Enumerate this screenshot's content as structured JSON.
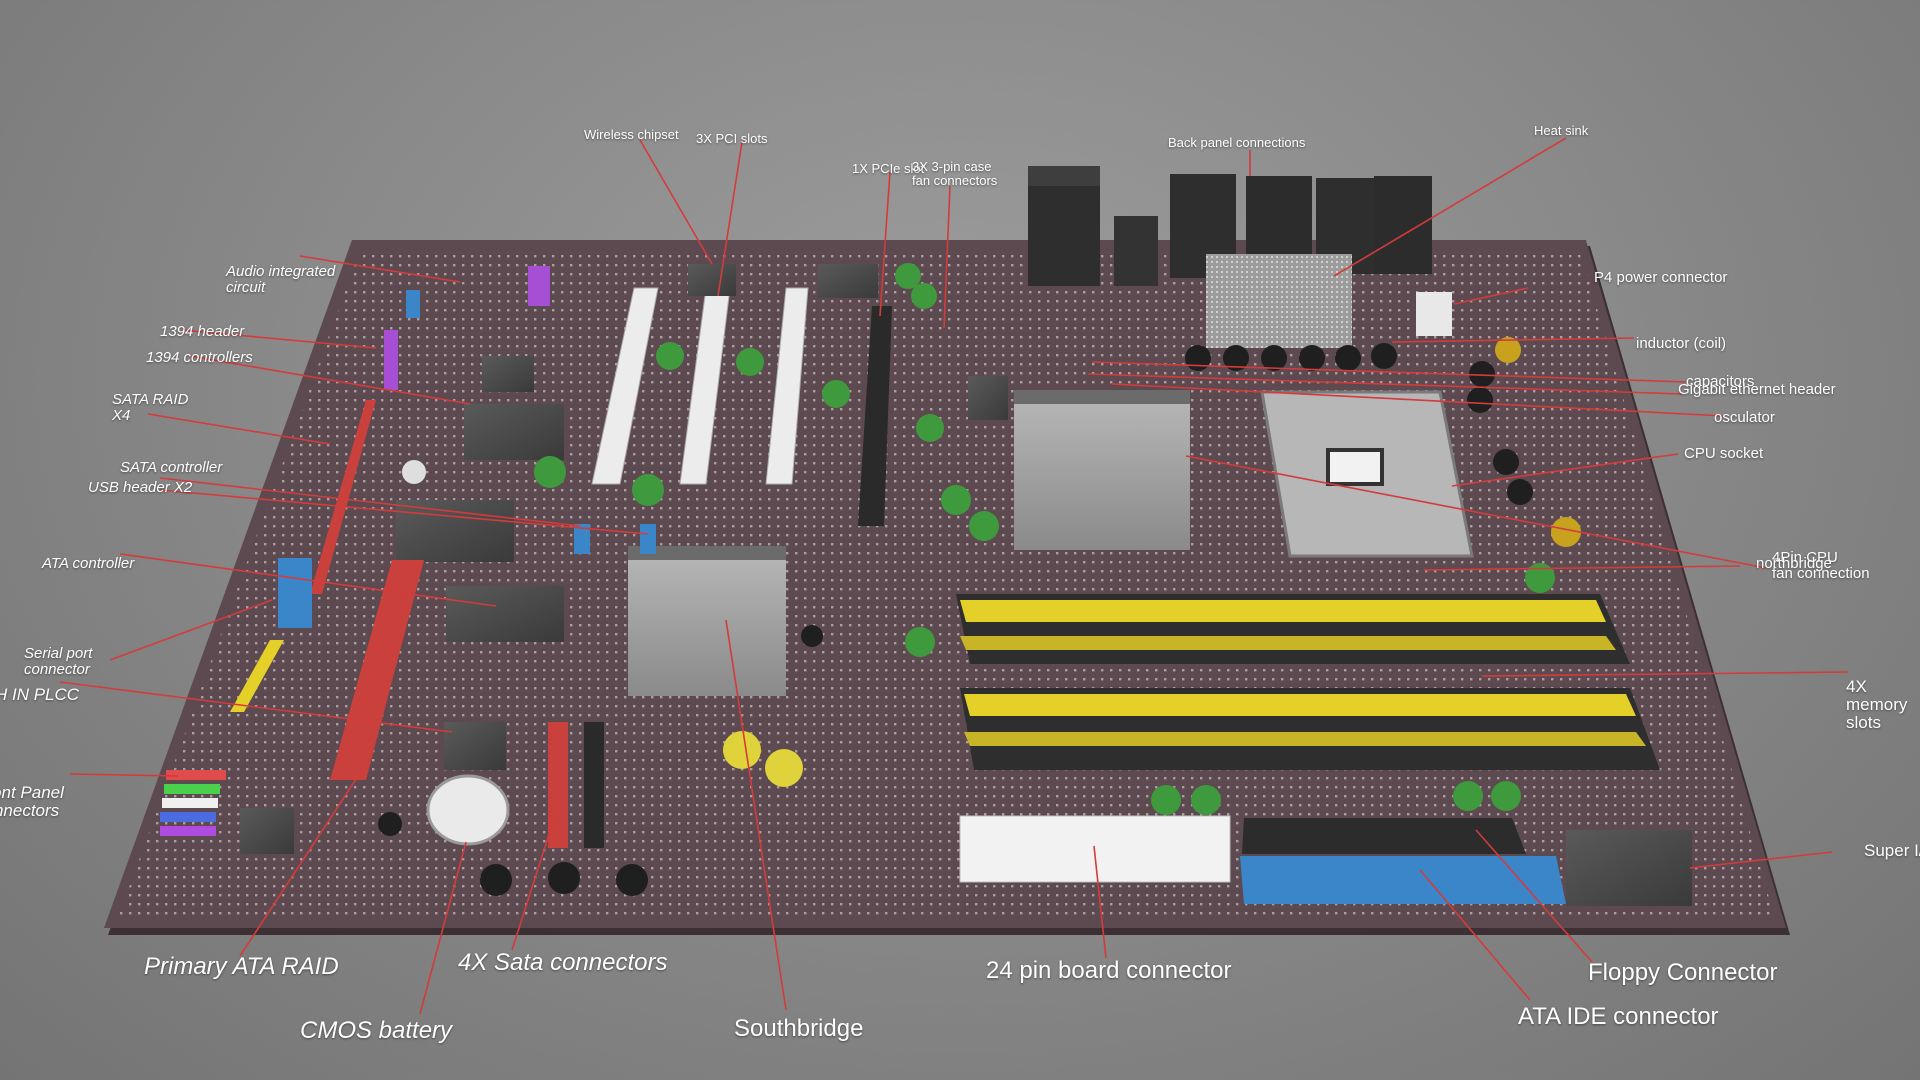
{
  "colors": {
    "background": "#8e8e8e",
    "board": "#5d4a50",
    "leader_line": "#d43b3b",
    "ram_slot": "#e5d02a",
    "sata_red": "#c9403c",
    "ide_blue": "#3b86c9",
    "capacitor_green": "#3e9a3c"
  },
  "labels": {
    "wireless_chipset": "Wireless chipset",
    "pci_slots": "3X PCI slots",
    "pcie_slot": "1X PCIe slot",
    "fan_connectors": "3X  3-pin case\nfan connectors",
    "back_panel": "Back panel connections",
    "heat_sink": "Heat sink",
    "audio": "Audio integrated\ncircuit",
    "p4_power": "P4 power connector",
    "h1394_header": "1394 header",
    "inductor": "inductor (coil)",
    "h1394_controllers": "1394 controllers",
    "capacitors": "capacitors",
    "gigabit": "Gigabit ethernet header",
    "sata_raid": "SATA RAID\nX4",
    "osculator": "osculator",
    "sata_controller": "SATA controller",
    "usb_header": "USB header X2",
    "cpu_socket": "CPU socket",
    "ata_controller": "ATA controller",
    "cpu_fan": "4Pin CPU\nfan connection",
    "northbridge": "northbridge",
    "serial_port": "Serial port\nconnector",
    "ich_plcc": "ICH IN PLCC",
    "mem_slots": "4X  memory\nslots",
    "front_panel": "Front Panel\nconnectors",
    "super_io": "Super I/O",
    "primary_ata": "Primary ATA RAID",
    "sata_connectors": "4X Sata connectors",
    "board_connector": "24 pin board connector",
    "floppy": "Floppy Connector",
    "cmos": "CMOS battery",
    "southbridge": "Southbridge",
    "ata_ide": "ATA IDE connector"
  }
}
